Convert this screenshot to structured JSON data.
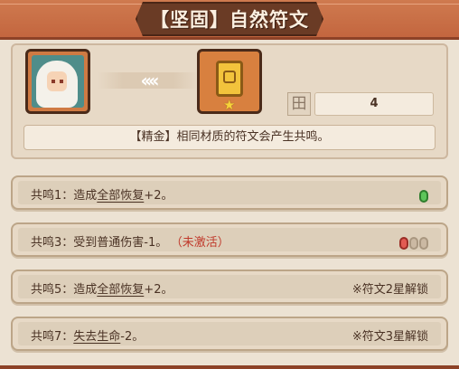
{
  "title": "【坚固】自然符文",
  "info": {
    "level_icon": "田",
    "level_value": "4",
    "description": "【精金】相同材质的符文会产生共鸣。",
    "arrows": "‹‹‹‹",
    "rune_star": "★"
  },
  "resonances": [
    {
      "prefix": "共鸣1：造成",
      "keyword": "全部恢复",
      "suffix": "+2。",
      "status": "",
      "right": "",
      "dots": [
        "green"
      ]
    },
    {
      "prefix": "共鸣3：受到普通伤害-1。",
      "keyword": "",
      "suffix": "",
      "status": "（未激活）",
      "right": "",
      "dots": [
        "red",
        "gray",
        "gray"
      ]
    },
    {
      "prefix": "共鸣5：造成",
      "keyword": "全部恢复",
      "suffix": "+2。",
      "status": "",
      "right": "※符文2星解锁",
      "dots": []
    },
    {
      "prefix": "共鸣7：",
      "keyword": "失去生命",
      "suffix": "-2。",
      "status": "",
      "right": "※符文3星解锁",
      "dots": []
    }
  ],
  "colors": {
    "banner": "#c3663f",
    "panel": "#e7d9c6",
    "active_dot": "#5ec55a",
    "inactive_dot": "#e25a52",
    "inactive_text": "#c0392b"
  }
}
